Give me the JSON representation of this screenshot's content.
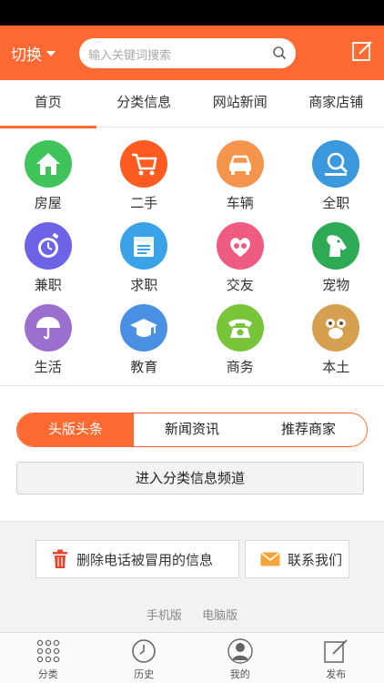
{
  "header": {
    "switch_label": "切换",
    "search_placeholder": "输入关键词搜索",
    "accent_color": "#ff6a33"
  },
  "tabs": [
    {
      "label": "首页",
      "active": true
    },
    {
      "label": "分类信息"
    },
    {
      "label": "网站新闻"
    },
    {
      "label": "商家店铺"
    }
  ],
  "categories": [
    {
      "label": "房屋",
      "icon": "house-icon",
      "color": "#3ec45b"
    },
    {
      "label": "二手",
      "icon": "cart-icon",
      "color": "#ff5a1f"
    },
    {
      "label": "车辆",
      "icon": "car-icon",
      "color": "#f5944b"
    },
    {
      "label": "全职",
      "icon": "search-person-icon",
      "color": "#3a98dd"
    },
    {
      "label": "兼职",
      "icon": "stopwatch-icon",
      "color": "#6e63e6"
    },
    {
      "label": "求职",
      "icon": "calendar-icon",
      "color": "#3aa3e8"
    },
    {
      "label": "交友",
      "icon": "hearts-icon",
      "color": "#ef5b81"
    },
    {
      "label": "宠物",
      "icon": "dog-icon",
      "color": "#2eaa55"
    },
    {
      "label": "生活",
      "icon": "umbrella-icon",
      "color": "#9b6fd0"
    },
    {
      "label": "教育",
      "icon": "graduation-cap-icon",
      "color": "#4a90e2"
    },
    {
      "label": "商务",
      "icon": "telephone-icon",
      "color": "#78c53a"
    },
    {
      "label": "本土",
      "icon": "paw-icon",
      "color": "#d6a050"
    }
  ],
  "segments": [
    {
      "label": "头版头条",
      "active": true
    },
    {
      "label": "新闻资讯"
    },
    {
      "label": "推荐商家"
    }
  ],
  "enter_channel_label": "进入分类信息频道",
  "actions": {
    "delete_label": "删除电话被冒用的信息",
    "contact_label": "联系我们"
  },
  "footer_links": {
    "mobile": "手机版",
    "desktop": "电脑版"
  },
  "bottom_nav": [
    {
      "label": "分类",
      "icon": "grid-dots-icon"
    },
    {
      "label": "历史",
      "icon": "clock-icon"
    },
    {
      "label": "我的",
      "icon": "user-icon"
    },
    {
      "label": "发布",
      "icon": "compose-icon"
    }
  ]
}
